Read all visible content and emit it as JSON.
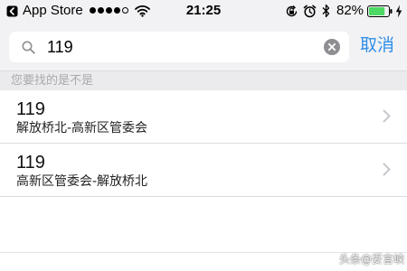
{
  "status_bar": {
    "app": "App Store",
    "time": "21:25",
    "battery": "82%",
    "battery_level": 0.82,
    "signal_bars_filled": 4,
    "signal_bars_total": 5,
    "icons": [
      "back-icon",
      "wifi-icon",
      "rotation-lock-icon",
      "alarm-icon",
      "bluetooth-icon",
      "battery-icon",
      "charging-icon"
    ]
  },
  "search": {
    "query": "119",
    "cancel_label": "取消",
    "icons": [
      "search-icon",
      "clear-icon"
    ]
  },
  "section": {
    "title": "您要找的是不是"
  },
  "results": [
    {
      "line": "119",
      "route": "解放桥北-高新区管委会"
    },
    {
      "line": "119",
      "route": "高新区管委会-解放桥北"
    }
  ],
  "watermark": "头条@妥言峡",
  "colors": {
    "accent": "#2f8ee9",
    "battery_fill": "#4cd964",
    "section_bg": "#ebebee",
    "bar_bg": "#f2f2f4",
    "section_text": "#a9a9ae"
  }
}
